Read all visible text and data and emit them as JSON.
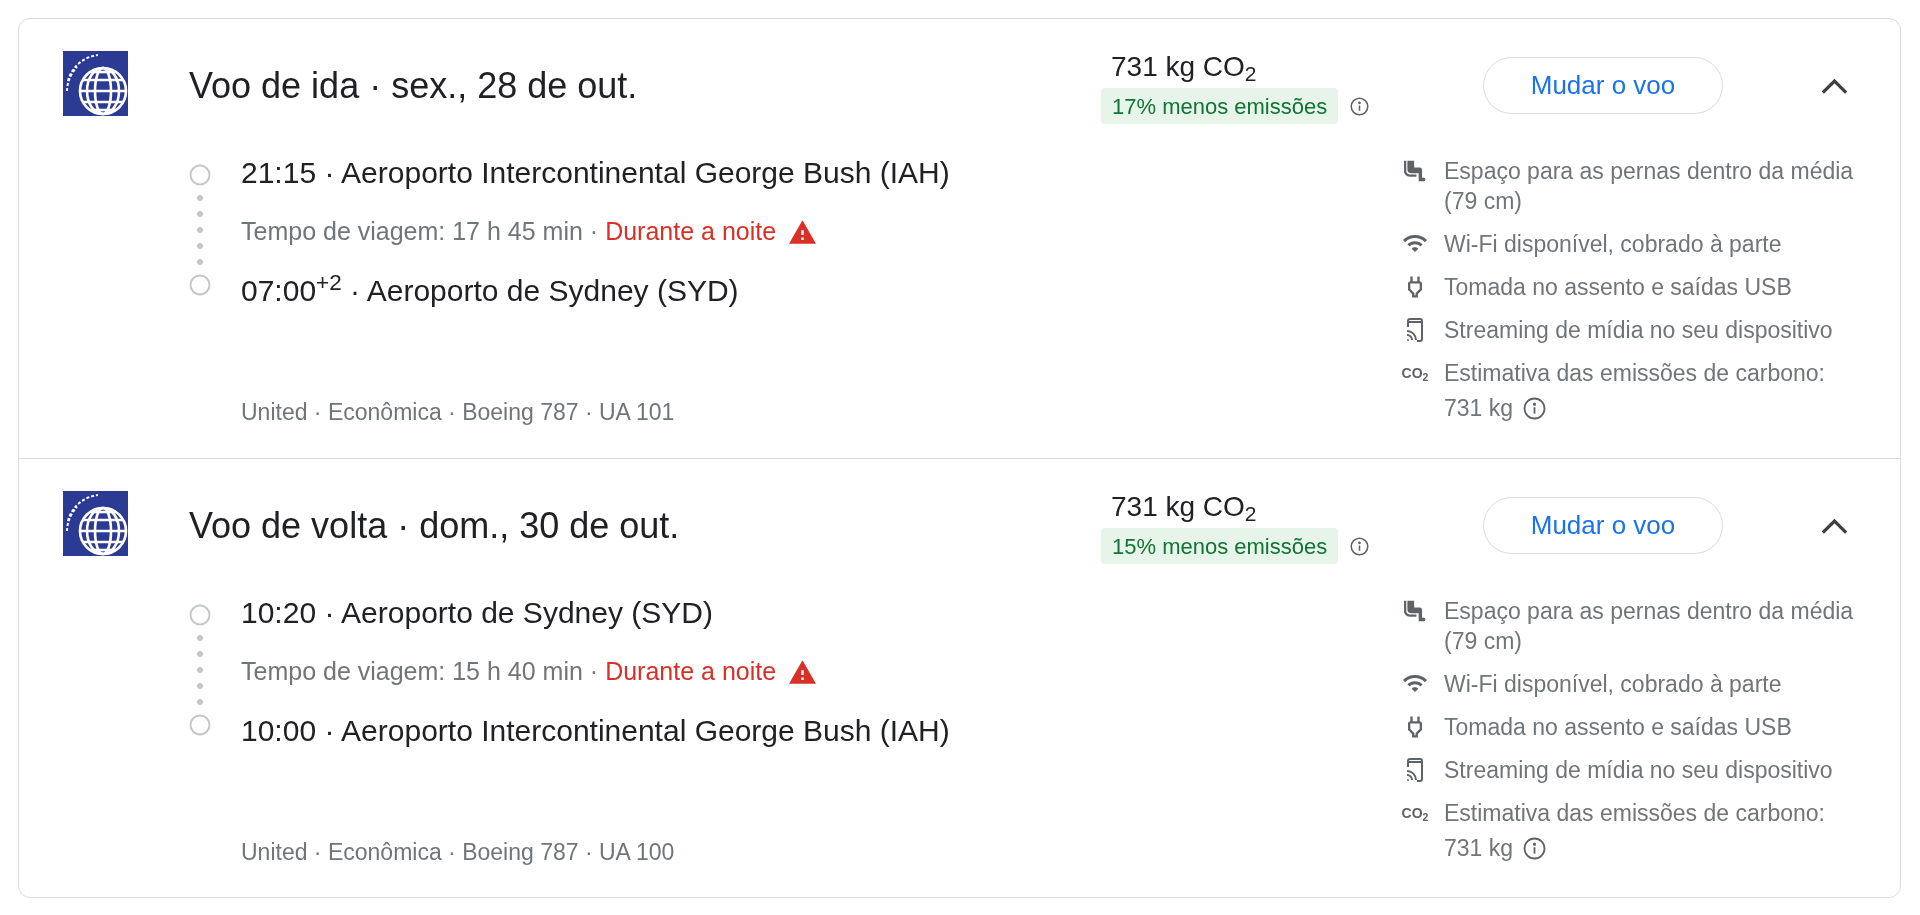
{
  "flights": [
    {
      "title": "Voo de ida · sex., 28 de out.",
      "expanded": true,
      "departure": "21:15 · Aeroporto Intercontinental George Bush (IAH)",
      "duration": "Tempo de viagem: 17 h 45 min ·",
      "overnight": "Durante a noite",
      "arrival": "07:00$^{+2}$ · Aeroporto de Sydney (SYD)",
      "details": "United · Econômica · Boeing 787 · UA 101",
      "emissions": "731 kg CO$_{2}$",
      "emissions_badge": "17% menos emissões",
      "button": "Mudar o voo",
      "amenities": [
        {
          "kind": "legroom",
          "text": "Espaço para as pernas dentro da média (79 cm)"
        },
        {
          "kind": "wifi",
          "text": "Wi-Fi disponível, cobrado à parte"
        },
        {
          "kind": "power",
          "text": "Tomada no assento e saídas USB"
        },
        {
          "kind": "streaming",
          "text": "Streaming de mídia no seu dispositivo"
        },
        {
          "kind": "co2",
          "symbol": "CO$_{2}$",
          "text": "Estimativa das emissões de carbono:",
          "value": "731 kg"
        }
      ]
    },
    {
      "title": "Voo de volta · dom., 30 de out.",
      "expanded": true,
      "departure": "10:20 · Aeroporto de Sydney (SYD)",
      "duration": "Tempo de viagem: 15 h 40 min ·",
      "overnight": "Durante a noite",
      "arrival": "10:00 · Aeroporto Intercontinental George Bush (IAH)",
      "details": "United · Econômica · Boeing 787 · UA 100",
      "emissions": "731 kg CO$_{2}$",
      "emissions_badge": "15% menos emissões",
      "button": "Mudar o voo",
      "amenities": [
        {
          "kind": "legroom",
          "text": "Espaço para as pernas dentro da média (79 cm)"
        },
        {
          "kind": "wifi",
          "text": "Wi-Fi disponível, cobrado à parte"
        },
        {
          "kind": "power",
          "text": "Tomada no assento e saídas USB"
        },
        {
          "kind": "streaming",
          "text": "Streaming de mídia no seu dispositivo"
        },
        {
          "kind": "co2",
          "symbol": "CO$_{2}$",
          "text": "Estimativa das emissões de carbono:",
          "value": "731 kg"
        }
      ]
    }
  ]
}
